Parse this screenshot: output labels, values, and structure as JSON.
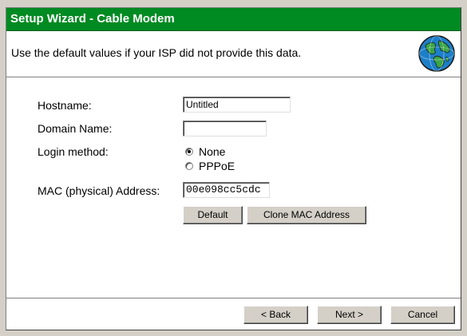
{
  "window": {
    "title": "Setup Wizard - Cable Modem",
    "instruction": "Use the default values if your ISP did not provide this data.",
    "globe_icon": "globe-icon"
  },
  "form": {
    "hostname_label": "Hostname:",
    "hostname_value": "Untitled",
    "domain_label": "Domain Name:",
    "domain_value": "",
    "login_label": "Login method:",
    "login_options": [
      "None",
      "PPPoE"
    ],
    "login_selected": "None",
    "mac_label": "MAC (physical) Address:",
    "mac_value": "00e098cc5cdc",
    "default_button": "Default",
    "clone_button": "Clone MAC Address"
  },
  "footer": {
    "back_button": "< Back",
    "next_button": "Next >",
    "cancel_button": "Cancel"
  },
  "colors": {
    "titlebar": "#008a22",
    "dialog_background": "#d4d0c8"
  }
}
